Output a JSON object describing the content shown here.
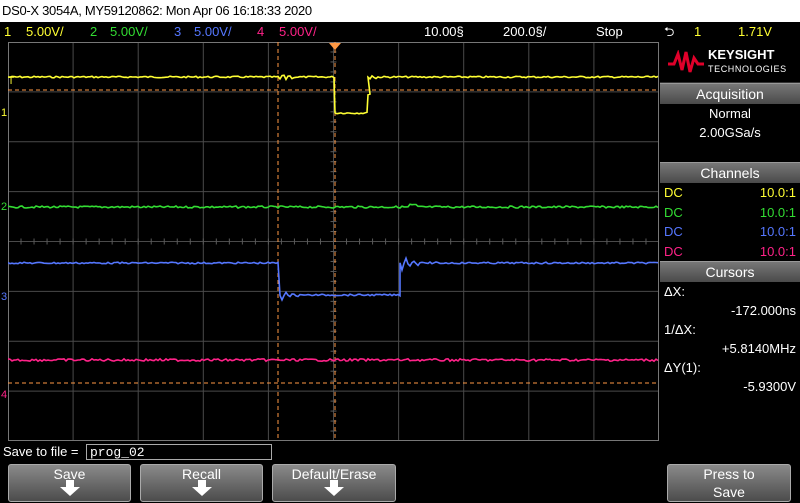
{
  "titlebar": {
    "text": "DS0-X 3054A, MY59120862: Mon Apr 06 16:18:33 2020"
  },
  "status": {
    "ch1_num": "1",
    "ch1_scale": "5.00V/",
    "ch2_num": "2",
    "ch2_scale": "5.00V/",
    "ch3_num": "3",
    "ch3_scale": "5.00V/",
    "ch4_num": "4",
    "ch4_scale": "5.00V/",
    "timebase": "10.00§",
    "sample": "200.0§/",
    "run_state": "Stop",
    "trig_symbol": "⮌",
    "trig_channel": "1",
    "trig_level": "1.71V"
  },
  "colors": {
    "ch1": "#ffff33",
    "ch2": "#33dd33",
    "ch3": "#5577ff",
    "ch4": "#ff2288",
    "cursor": "#ff9944"
  },
  "markers": {
    "trigger": "T",
    "ch1": "1",
    "ch2": "2",
    "ch3": "3",
    "ch4": "4"
  },
  "logo": {
    "brand": "KEYSIGHT",
    "sub": "TECHNOLOGIES",
    "icon": "keysight-wave-icon"
  },
  "acquisition": {
    "header": "Acquisition",
    "mode": "Normal",
    "rate": "2.00GSa/s"
  },
  "channels": {
    "header": "Channels",
    "rows": [
      {
        "coupling": "DC",
        "probe": "10.0:1"
      },
      {
        "coupling": "DC",
        "probe": "10.0:1"
      },
      {
        "coupling": "DC",
        "probe": "10.0:1"
      },
      {
        "coupling": "DC",
        "probe": "10.0:1"
      }
    ]
  },
  "cursors": {
    "header": "Cursors",
    "dx_label": "ΔX:",
    "dx_value": "-172.000ns",
    "inv_label": "1/ΔX:",
    "inv_value": "+5.8140MHz",
    "dy_label": "ΔY(1):",
    "dy_value": "-5.9300V"
  },
  "savebar": {
    "label": "Save to file =",
    "filename": "prog_02"
  },
  "softkeys": {
    "save": "Save",
    "recall": "Recall",
    "default": "Default/Erase",
    "press1": "Press to",
    "press2": "Save"
  }
}
